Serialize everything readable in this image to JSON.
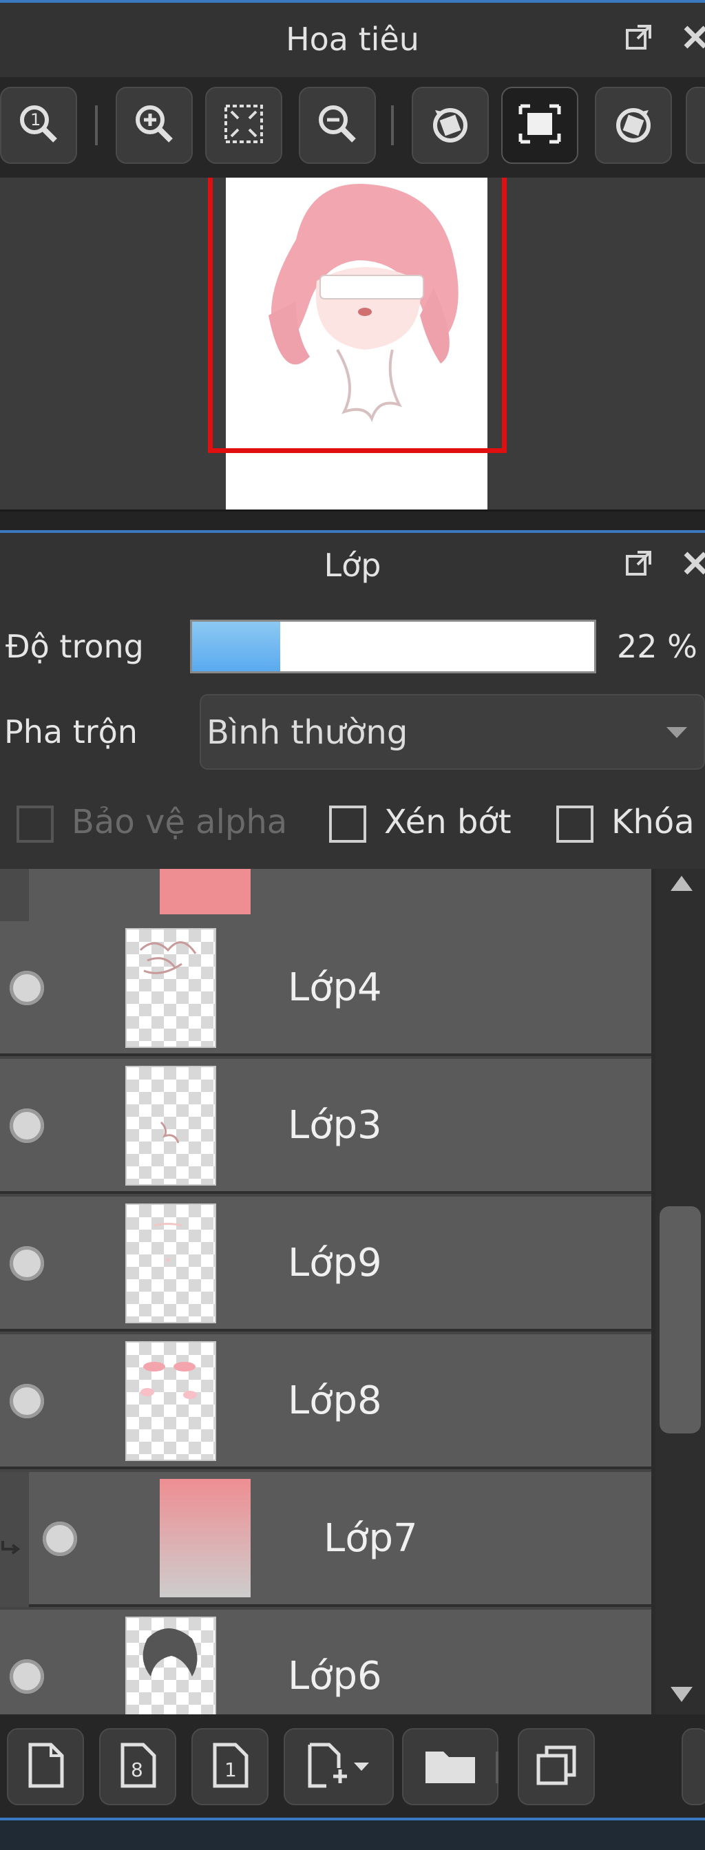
{
  "navigator": {
    "title": "Hoa tiêu"
  },
  "layers": {
    "title": "Lớp",
    "opacity_label": "Độ trong",
    "opacity_value": "22 %",
    "opacity_fraction": 0.22,
    "blend_label": "Pha trộn",
    "blend_mode": "Bình thường",
    "options": {
      "protect_alpha": "Bảo vệ alpha",
      "clipping": "Xén bớt",
      "lock": "Khóa"
    },
    "items": [
      {
        "name": "Lớp4"
      },
      {
        "name": "Lớp3"
      },
      {
        "name": "Lớp9"
      },
      {
        "name": "Lớp8"
      },
      {
        "name": "Lớp7"
      },
      {
        "name": "Lớp6"
      }
    ]
  },
  "colors": {
    "accent": "#3a78c2",
    "frame_red": "#e01010",
    "layer_pink": "#ee8e92"
  }
}
